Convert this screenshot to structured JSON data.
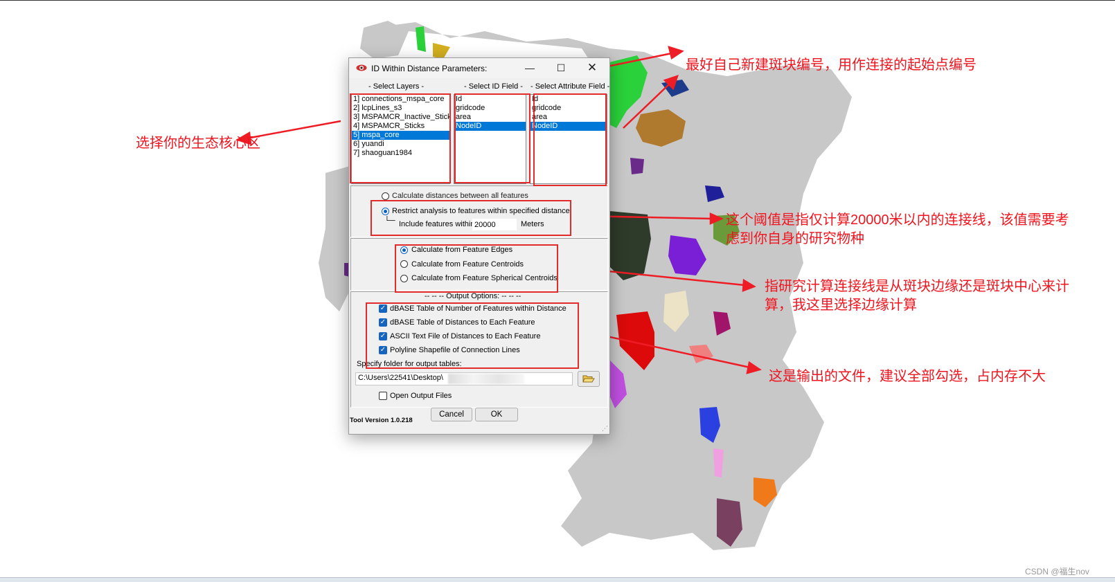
{
  "dialog": {
    "title": "ID Within Distance Parameters:",
    "window_controls": {
      "minimize": "—",
      "maximize": "☐",
      "close": "✕"
    },
    "sections": {
      "layers_label": "- Select Layers -",
      "id_field_label": "- Select ID Field -",
      "attr_field_label": "- Select Attribute Field -"
    },
    "layers": [
      "1] connections_mspa_core",
      "2] lcpLines_s3",
      "3] MSPAMCR_Inactive_Sticks",
      "4] MSPAMCR_Sticks",
      "5] mspa_core",
      "6] yuandi",
      "7] shaoguan1984"
    ],
    "layers_selected_index": 4,
    "id_fields": [
      "Id",
      "gridcode",
      "area",
      "NodeID"
    ],
    "id_fields_selected_index": 3,
    "attr_fields": [
      "Id",
      "gridcode",
      "area",
      "NodeID"
    ],
    "attr_fields_selected_index": 3,
    "distance_options": {
      "all_features": "Calculate distances between all features",
      "restrict": "Restrict analysis to features within specified distance",
      "include_within": "Include features within",
      "distance_value": "20000",
      "unit": "Meters",
      "selected": "restrict"
    },
    "calc_options": {
      "edges": "Calculate from Feature Edges",
      "centroids": "Calculate from Feature Centroids",
      "spherical": "Calculate from Feature Spherical Centroids",
      "selected": "edges"
    },
    "output": {
      "header": "-- -- -- Output Options: -- -- --",
      "items": [
        {
          "label": "dBASE Table of Number of Features within Distance",
          "checked": true
        },
        {
          "label": "dBASE Table of Distances to Each Feature",
          "checked": true
        },
        {
          "label": "ASCII Text File of Distances to Each Feature",
          "checked": true
        },
        {
          "label": "Polyline Shapefile of Connection Lines",
          "checked": true
        }
      ],
      "folder_label": "Specify folder for output tables:",
      "folder_path": "C:\\Users\\22541\\Desktop\\",
      "open_output_label": "Open Output Files",
      "open_output_checked": false
    },
    "tool_version": "Tool Version 1.0.218",
    "cancel_label": "Cancel",
    "ok_label": "OK"
  },
  "annotations": {
    "top": "最好自己新建斑块编号，用作连接的起始点编号",
    "left": "选择你的生态核心区",
    "threshold_line1": "这个阈值是指仅计算20000米以内的连接线，该值需要考",
    "threshold_line2": "虑到你自身的研究物种",
    "calc_line1": "指研究计算连接线是从斑块边缘还是斑块中心来计",
    "calc_line2": "算，我这里选择边缘计算",
    "output": "这是输出的文件，建议全部勾选，占内存不大"
  },
  "watermark": "CSDN @福生nov",
  "colors": {
    "annotation_red": "#f0141e",
    "selection_blue": "#0078d7",
    "map_gray": "#c8c8c8"
  }
}
